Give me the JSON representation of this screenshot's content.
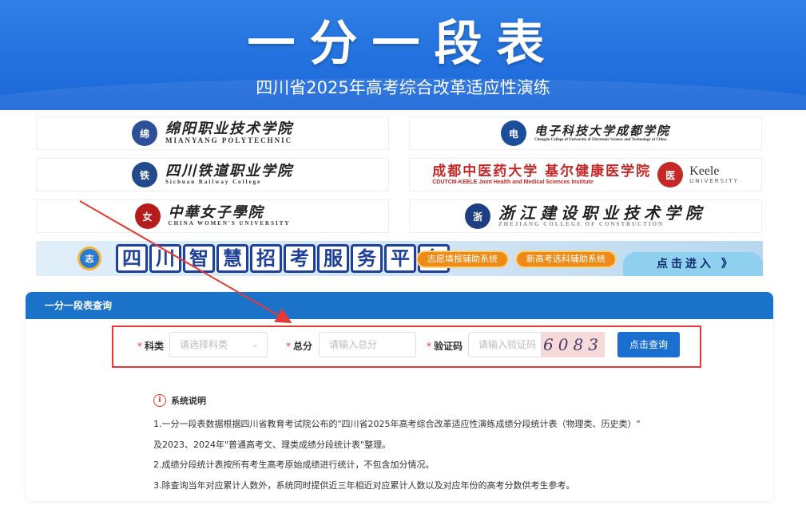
{
  "hero": {
    "title": "一分一段表",
    "subtitle": "四川省2025年高考综合改革适应性演练"
  },
  "logos": [
    {
      "cn": "绵阳职业技术学院",
      "en": "MIANYANG POLYTECHNIC",
      "seal": "绵",
      "color": "#2c4f9a"
    },
    {
      "cn": "电子科技大学成都学院",
      "en": "Chengdu College of University of Electronic Science and Technology of China",
      "seal": "电",
      "color": "#1b4d9b"
    },
    {
      "cn": "四川铁道职业学院",
      "en": "Sichuan Railway College",
      "seal": "铁",
      "color": "#234a8c"
    },
    {
      "cn": "成都中医药大学 基尔健康医学院",
      "en": "CDUTCM-KEELE Joint Health and Medical Sciences Institute",
      "seal": "医",
      "color": "#c62828",
      "extra": "Keele",
      "extra_sub": "UNIVERSITY"
    },
    {
      "cn": "中華女子學院",
      "en": "CHINA WOMEN'S UNIVERSITY",
      "seal": "女",
      "color": "#b71c1c"
    },
    {
      "cn": "浙江建设职业技术学院",
      "en": "ZHEJIANG COLLEGE OF CONSTRUCTION",
      "seal": "浙",
      "color": "#1d3f82"
    }
  ],
  "banner": {
    "badge": "志",
    "title_chars": [
      "四",
      "川",
      "智",
      "慧",
      "招",
      "考",
      "服",
      "务",
      "平",
      "台"
    ],
    "pill1": "志愿填报辅助系统",
    "pill2": "新高考选科辅助系统",
    "enter": "点击进入 》"
  },
  "panel": {
    "title": "一分一段表查询",
    "subject_label": "科类",
    "subject_placeholder": "请选择科类",
    "score_label": "总分",
    "score_placeholder": "请输入总分",
    "captcha_label": "验证码",
    "captcha_placeholder": "请输入验证码",
    "captcha_code": "6083",
    "submit": "点击查询",
    "required_mark": "*"
  },
  "notes": {
    "heading": "系统说明",
    "info_glyph": "i",
    "lines": [
      "1.一分一段表数据根据四川省教育考试院公布的\"四川省2025年高考综合改革适应性演练成绩分段统计表（物理类、历史类）\"",
      "及2023、2024年\"普通高考文、理类成绩分段统计表\"整理。",
      "2.成绩分段统计表按所有考生高考原始成绩进行统计，不包含加分情况。",
      "3.除查询当年对应累计人数外，系统同时提供近三年相近对应累计人数以及对应年份的高考分数供考生参考。"
    ]
  },
  "colors": {
    "primary": "#1a6fd0",
    "accent_red": "#e53935",
    "hero_blue": "#2f7fe6"
  }
}
